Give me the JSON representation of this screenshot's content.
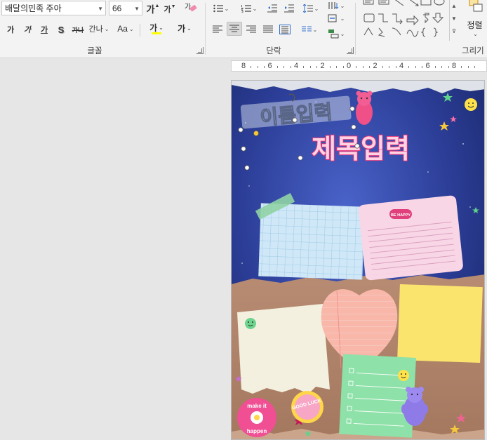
{
  "ribbon": {
    "font": {
      "font_name": "배달의민족 주아",
      "font_size": "66",
      "grow_label": "가",
      "shrink_label": "가",
      "clear_label": "가",
      "bold": "가",
      "italic": "가",
      "underline": "가",
      "shadow": "S",
      "strike": "가나",
      "spacing": "간나",
      "case": "Aa",
      "highlight": "가",
      "color": "가",
      "group_label": "글꼴"
    },
    "paragraph": {
      "group_label": "단락"
    },
    "drawing": {
      "arrange_label": "정렬",
      "group_label": "그리기"
    }
  },
  "ruler": {
    "ticks": [
      "8",
      "6",
      "4",
      "2",
      "0",
      "2",
      "4",
      "6",
      "8"
    ]
  },
  "slide": {
    "name_text": "이름입력",
    "title_text": "제목입력",
    "be_happy": "BE HAPPY",
    "good_luck": "GOOD LUCK",
    "make_it": "make it",
    "happen": "happen"
  }
}
